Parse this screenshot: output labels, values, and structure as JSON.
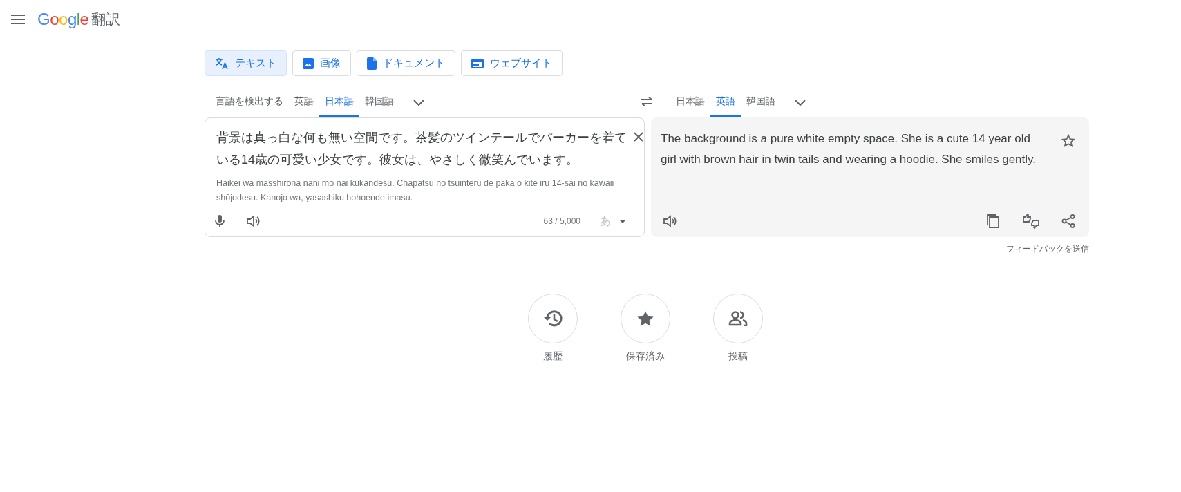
{
  "header": {
    "logo": "Google",
    "product": "翻訳"
  },
  "modes": [
    {
      "label": "テキスト",
      "selected": true
    },
    {
      "label": "画像",
      "selected": false
    },
    {
      "label": "ドキュメント",
      "selected": false
    },
    {
      "label": "ウェブサイト",
      "selected": false
    }
  ],
  "source_languages": [
    {
      "label": "言語を検出する",
      "selected": false
    },
    {
      "label": "英語",
      "selected": false
    },
    {
      "label": "日本語",
      "selected": true
    },
    {
      "label": "韓国語",
      "selected": false
    }
  ],
  "target_languages": [
    {
      "label": "日本語",
      "selected": false
    },
    {
      "label": "英語",
      "selected": true
    },
    {
      "label": "韓国語",
      "selected": false
    }
  ],
  "source": {
    "text": "背景は真っ白な何も無い空間です。茶髪のツインテールでパーカーを着ている14歳の可愛い少女です。彼女は、やさしく微笑んでいます。",
    "romanization": "Haikei wa masshirona nani mo nai kūkandesu. Chapatsu no tsuintēru de pākā o kite iru 14-sai no kawaii shōjodesu. Kanojo wa, yasashiku hohoende imasu.",
    "char_count": "63 / 5,000",
    "input_tool": "あ"
  },
  "target": {
    "text": "The background is a pure white empty space. She is a cute 14 year old girl with brown hair in twin tails and wearing a hoodie. She smiles gently.",
    "feedback": "フィードバックを送信"
  },
  "shortcuts": [
    {
      "label": "履歴"
    },
    {
      "label": "保存済み"
    },
    {
      "label": "投稿"
    }
  ]
}
